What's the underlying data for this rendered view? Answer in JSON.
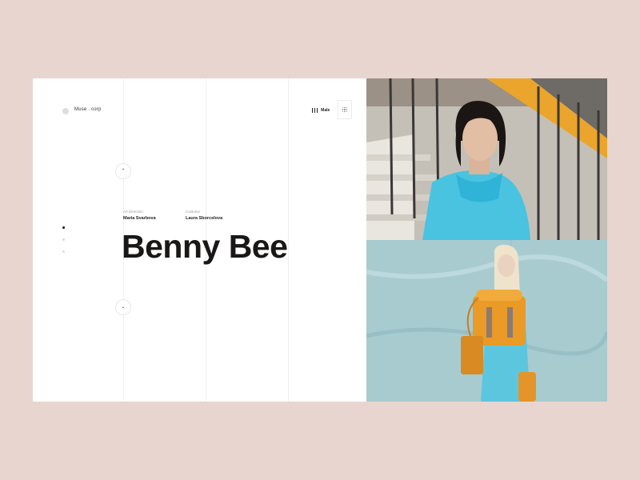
{
  "brand": {
    "name": "Muse . corp"
  },
  "menu": {
    "label": "Male"
  },
  "credits": [
    {
      "label": "Art Direction",
      "value": "Maria Svarbova"
    },
    {
      "label": "Costume",
      "value": "Laura Sborcelova"
    }
  ],
  "headline": "Benny Bee",
  "nav": {
    "up_glyph": "⌃",
    "down_glyph": "⌄"
  },
  "pager": {
    "count": 3,
    "active": 1
  },
  "images": [
    {
      "subject": "woman-in-blue-jacket-photo"
    },
    {
      "subject": "woman-with-orange-backpack-photo"
    }
  ],
  "colors": {
    "background": "#e8d5d0",
    "card": "#ffffff",
    "text": "#1a1717",
    "accent_blue": "#43c1de",
    "accent_orange": "#e89a2a"
  }
}
